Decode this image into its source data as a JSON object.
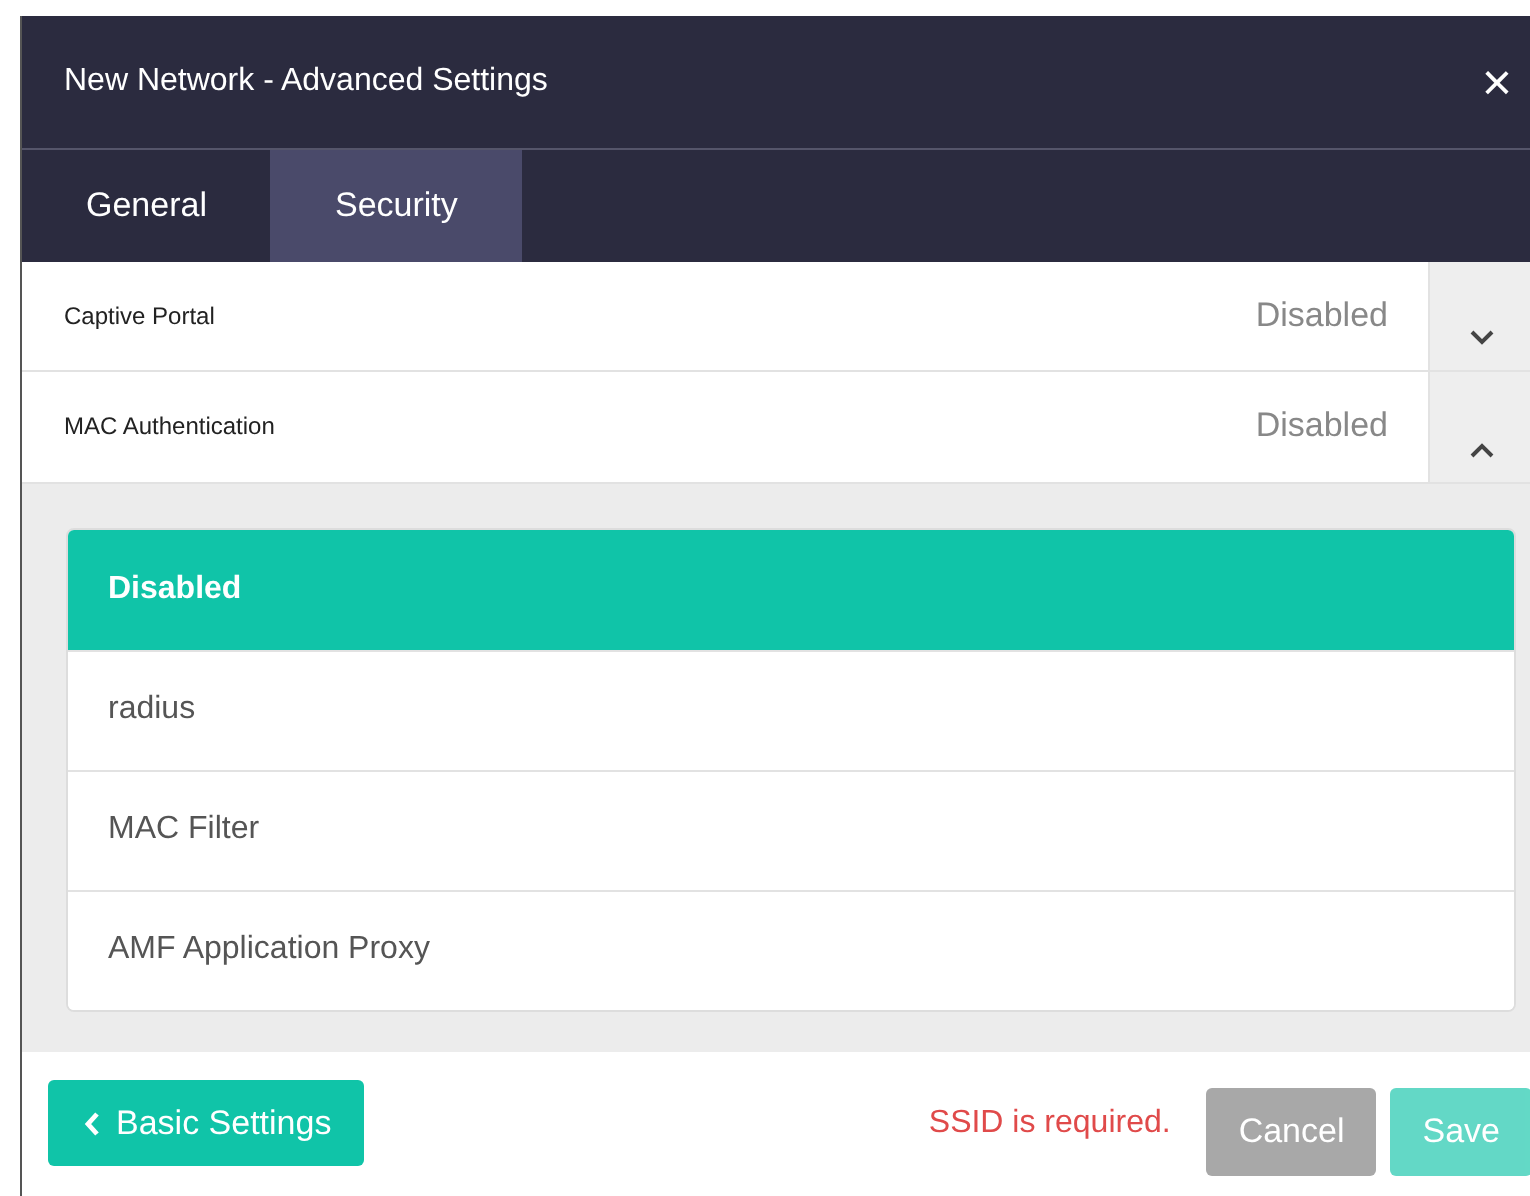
{
  "window": {
    "title": "New Network - Advanced Settings",
    "close": "×"
  },
  "tabs": [
    {
      "label": "General",
      "selected": false
    },
    {
      "label": "Security",
      "selected": true
    }
  ],
  "sections": [
    {
      "label": "Captive Portal",
      "value": "Disabled",
      "expanded": false
    },
    {
      "label": "MAC Authentication",
      "value": "Disabled",
      "expanded": true,
      "options": [
        {
          "label": "Disabled",
          "selected": true
        },
        {
          "label": "radius",
          "selected": false
        },
        {
          "label": "MAC Filter",
          "selected": false
        },
        {
          "label": "AMF Application Proxy",
          "selected": false
        }
      ]
    }
  ],
  "footer": {
    "back_button": "Basic Settings",
    "error": "SSID is required.",
    "buttons": [
      {
        "label": "Cancel",
        "kind": "cancel",
        "disabled": false
      },
      {
        "label": "Save",
        "kind": "save",
        "disabled": true
      }
    ]
  }
}
